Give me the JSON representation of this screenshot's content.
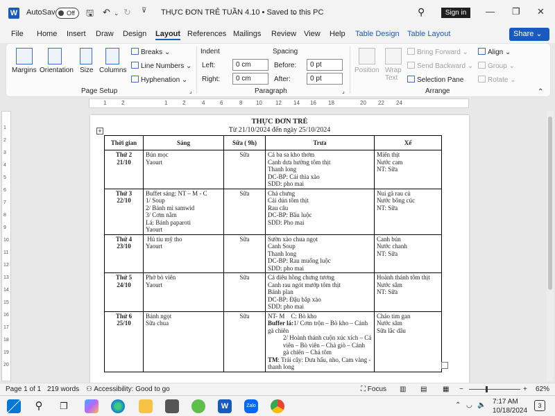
{
  "titlebar": {
    "autosave": "AutoSave",
    "toggle": "Off",
    "doc_title": "THỰC ĐƠN TRẺ TUẦN 4.10 • Saved to this PC",
    "signin": "Sign in"
  },
  "menu": [
    "File",
    "Home",
    "Insert",
    "Draw",
    "Design",
    "Layout",
    "References",
    "Mailings",
    "Review",
    "View",
    "Help",
    "Table Design",
    "Table Layout"
  ],
  "share": "Share",
  "ribbon": {
    "page_setup": {
      "margins": "Margins",
      "orientation": "Orientation",
      "size": "Size",
      "columns": "Columns",
      "breaks": "Breaks",
      "line_numbers": "Line Numbers",
      "hyphenation": "Hyphenation",
      "group": "Page Setup"
    },
    "paragraph": {
      "indent": "Indent",
      "left_label": "Left:",
      "left_value": "0 cm",
      "right_label": "Right:",
      "right_value": "0 cm",
      "spacing": "Spacing",
      "before_label": "Before:",
      "before_value": "0 pt",
      "after_label": "After:",
      "after_value": "0 pt",
      "group": "Paragraph"
    },
    "arrange": {
      "position": "Position",
      "wrap": "Wrap",
      "text": "Text",
      "bring_forward": "Bring Forward",
      "send_backward": "Send Backward",
      "selection_pane": "Selection Pane",
      "align": "Align",
      "group_btn": "Group",
      "rotate": "Rotate",
      "group": "Arrange"
    }
  },
  "ruler": [
    "1",
    "2",
    "1",
    "2",
    "4",
    "6",
    "8",
    "10",
    "12",
    "14",
    "16",
    "18",
    "20",
    "22",
    "24"
  ],
  "vruler": [
    "1",
    "2",
    "3",
    "4",
    "5",
    "6",
    "7",
    "8",
    "9",
    "10",
    "11",
    "12",
    "13",
    "14",
    "15",
    "16",
    "17",
    "18",
    "19",
    "20"
  ],
  "doc": {
    "title": "THỰC ĐƠN TRẺ",
    "subtitle": "Từ 21/10/2024 đến ngày 25/10/2024",
    "headers": [
      "Thời gian",
      "Sáng",
      "Sữa ( 9h)",
      "Trưa",
      "Xế"
    ],
    "rows": [
      {
        "day": [
          "Thứ 2",
          "21/10"
        ],
        "morning": [
          "Bún mọc",
          "Yaourt"
        ],
        "milk": "Sữa",
        "lunch": [
          "Cá ba sa kho thơm",
          "Canh dưa hường tôm thịt",
          "Thanh long",
          "DC-BP: Cải thìa xào",
          "SDD: pho mai"
        ],
        "afternoon": [
          "Miến thịt",
          "Nước cam",
          "NT: Sữa"
        ]
      },
      {
        "day": [
          "Thứ 3",
          "22/10"
        ],
        "morning": [
          "Buffet sáng: NT – M - C",
          "1/ Soup",
          "2/ Bánh mì samwid",
          "3/ Cơm nắm",
          "Lá: Bánh paparoti",
          "Yaourt"
        ],
        "milk": "Sữa",
        "lunch": [
          "Chả chưng",
          "Cải dún tôm thịt",
          "Rau câu",
          "DC-BP: Bầu luộc",
          "SDD: Pho mai"
        ],
        "afternoon": [
          "Nui gà rau củ",
          "Nước bông cúc",
          "NT: Sữa"
        ]
      },
      {
        "day": [
          "Thứ 4",
          "23/10"
        ],
        "morning": [
          " Hủ tíu mỹ tho",
          "Yaourt"
        ],
        "milk": "Sữa",
        "lunch": [
          "Sườn xào chua ngọt",
          "Canh Soup",
          "Thanh long",
          "DC-BP: Rau muống luộc",
          "SDD: pho mai"
        ],
        "afternoon": [
          "Canh bún",
          "Nước chanh",
          "NT: Sữa"
        ]
      },
      {
        "day": [
          "Thứ 5",
          "24/10"
        ],
        "morning": [
          "Phở bò viên",
          "Yaourt"
        ],
        "milk": "Sữa",
        "lunch": [
          "Cá diêu hồng chưng tương",
          "Canh rau ngót mướp tôm thịt",
          "Bánh plan",
          "DC-BP: Đậu bắp xào",
          "SDD: pho mai"
        ],
        "afternoon": [
          "Hoành thánh tôm thịt",
          "Nước sâm",
          "NT: Sữa"
        ]
      },
      {
        "day": [
          "Thứ 6",
          "25/10"
        ],
        "morning": [
          "Bánh ngọt",
          "Sữa chua"
        ],
        "milk": "Sữa",
        "lunch_nt": "NT- M    C: Bò kho",
        "lunch_buffet_label": "Buffer lá:",
        "lunch_buffet_1": "1/ Cơm trộn – Bò kho – Cánh gà chiên",
        "lunch_buffet_2": "2/ Hoành thánh  cuộn xúc xích  – Cá viên – Bò viên – Chả giò – Cánh gà chiên – Chả tôm",
        "lunch_tm_label": "TM",
        "lunch_tm": ": Trái cây: Dưa hấu, nho, Cam vàng - thanh long",
        "afternoon": [
          "Cháo tim gan",
          "Nước sâm",
          "Sữa lắc dâu"
        ]
      }
    ]
  },
  "status": {
    "page": "Page 1 of 1",
    "words": "219 words",
    "accessibility": "Accessibility: Good to go",
    "focus": "Focus",
    "zoom": "62%"
  },
  "taskbar": {
    "time": "7:17 AM",
    "date": "10/18/2024",
    "notif": "3"
  }
}
